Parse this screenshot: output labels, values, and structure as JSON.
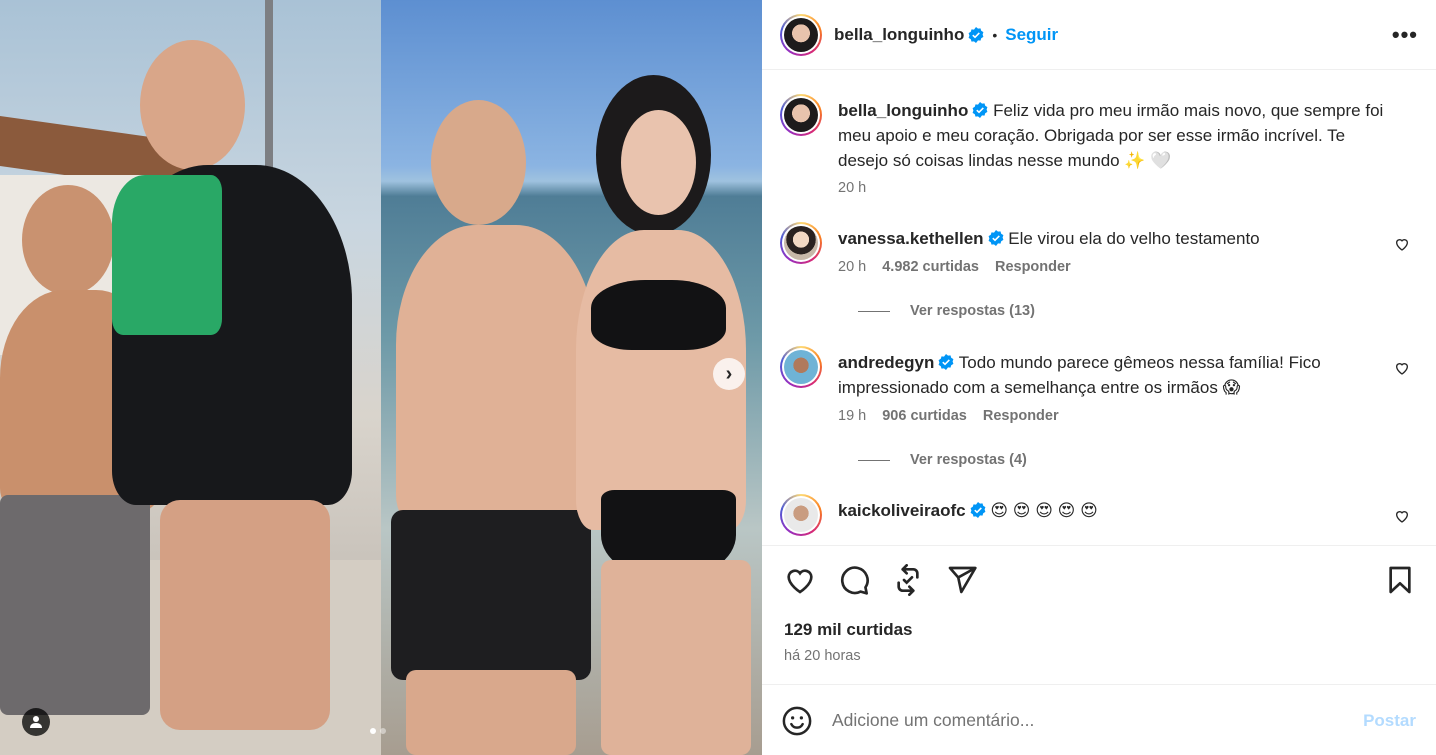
{
  "header": {
    "username": "bella_longuinho",
    "separator": "•",
    "follow_label": "Seguir",
    "more_label": "•••"
  },
  "caption": {
    "username": "bella_longuinho",
    "text": "Feliz vida pro meu irmão mais novo, que sempre foi meu apoio e meu coração. Obrigada por ser esse irmão incrível. Te desejo só coisas lindas nesse mundo ✨ 🤍",
    "time": "20 h"
  },
  "comments": [
    {
      "username": "vanessa.kethellen",
      "text": "Ele virou ela do velho testamento",
      "time": "20 h",
      "likes": "4.982 curtidas",
      "reply_label": "Responder",
      "view_replies": "Ver respostas (13)"
    },
    {
      "username": "andredegyn",
      "text": "Todo mundo parece gêmeos nessa família! Fico impressionado com a semelhança entre os irmãos 😱",
      "time": "19 h",
      "likes": "906 curtidas",
      "reply_label": "Responder",
      "view_replies": "Ver respostas (4)"
    },
    {
      "username": "kaickoliveiraofc",
      "text": "😍 😍 😍 😍 😍"
    }
  ],
  "post": {
    "likes": "129 mil curtidas",
    "time": "há 20 horas"
  },
  "add_comment": {
    "placeholder": "Adicione um comentário...",
    "post_label": "Postar"
  },
  "carousel": {
    "next_glyph": "›",
    "slide_count": 2,
    "active_slide": 1
  },
  "colors": {
    "accent": "#0095f6",
    "post_disabled": "#b3dbff",
    "secondary_text": "#737373",
    "verified": "#0095f6"
  },
  "icons": [
    "user-tag-icon",
    "chevron-right-icon",
    "verified-icon",
    "more-icon",
    "heart-icon",
    "comment-icon",
    "repost-icon",
    "share-icon",
    "bookmark-icon",
    "emoji-icon"
  ]
}
